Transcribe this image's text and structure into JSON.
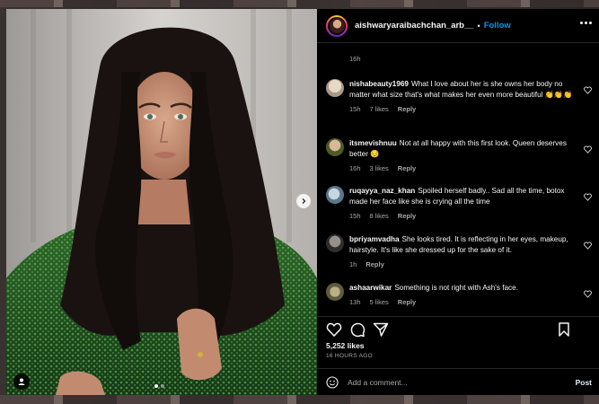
{
  "post": {
    "username": "aishwaryaraibachchan_arb__",
    "separator": "•",
    "follow_label": "Follow",
    "caption_time": "16h",
    "likes": "5,252 likes",
    "posted_ago": "16 HOURS AGO"
  },
  "comments": [
    {
      "user": "nishabeauty1969",
      "text": "What I love about her is she owns her body no matter what size that's what makes her even more beautiful 👏👏👏",
      "time": "15h",
      "likes": "7 likes",
      "reply": "Reply",
      "avatar_color": "#c9b9a8"
    },
    {
      "user": "itsmevishnuu",
      "text": "Not at all happy with this first look. Queen deserves better 😔",
      "time": "16h",
      "likes": "3 likes",
      "reply": "Reply",
      "avatar_color": "#6f7a3a"
    },
    {
      "user": "ruqayya_naz_khan",
      "text": "Spoiled herself badly.. Sad all the time, botox made her face like she is crying all the time",
      "time": "15h",
      "likes": "8 likes",
      "reply": "Reply",
      "avatar_color": "#8aa0b0"
    },
    {
      "user": "bpriyamvadha",
      "text": "She looks tired. It is reflecting in her eyes, makeup, hairstyle. It's like she dressed up for the sake of it.",
      "time": "1h",
      "likes": "",
      "reply": "Reply",
      "avatar_color": "#4a4a4a"
    },
    {
      "user": "ashaarwikar",
      "text": "Something is not right with Ash's face.",
      "time": "13h",
      "likes": "5 likes",
      "reply": "Reply",
      "avatar_color": "#7a7a5a"
    }
  ],
  "add_comment": {
    "placeholder": "Add a comment...",
    "post_label": "Post"
  },
  "carousel": {
    "total": 2,
    "active_index": 0
  },
  "icons": {
    "like": "heart-icon",
    "comment": "comment-icon",
    "share": "share-icon",
    "save": "bookmark-icon",
    "more": "more-icon",
    "next": "chevron-right-icon",
    "tag": "person-tag-icon",
    "emoji": "emoji-icon"
  },
  "colors": {
    "follow": "#0095f6",
    "background": "#000000",
    "secondary_text": "#a8a8a8"
  }
}
